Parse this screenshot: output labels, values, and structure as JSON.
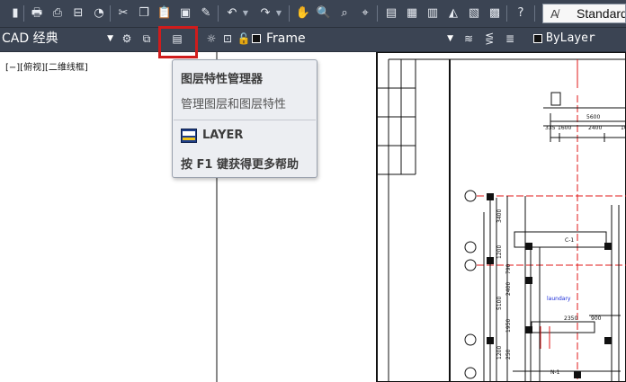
{
  "toolbar": {
    "text_style": "Standard"
  },
  "layers_toolbar": {
    "workspace": "CAD 经典",
    "current_layer": "Frame",
    "color": "ByLayer"
  },
  "viewport": {
    "label": "[−][俯视][二维线框]"
  },
  "tooltip": {
    "title": "图层特性管理器",
    "description": "管理图层和图层特性",
    "command": "LAYER",
    "help": "按 F1 键获得更多帮助"
  },
  "drawing": {
    "dims_top": [
      "5600",
      "1600",
      "2400",
      "1600"
    ],
    "dims_left": [
      "3400",
      "1200",
      "790",
      "2400",
      "5100",
      "1950",
      "250",
      "1200"
    ],
    "tags": [
      "C-1",
      "2350",
      "900",
      "N-1"
    ],
    "room_label": "laundary"
  },
  "colors": {
    "toolbar_bg": "#3b4453",
    "highlight": "#d01c1c",
    "tooltip_bg": "#eceef2",
    "dim_red": "#e01818"
  }
}
